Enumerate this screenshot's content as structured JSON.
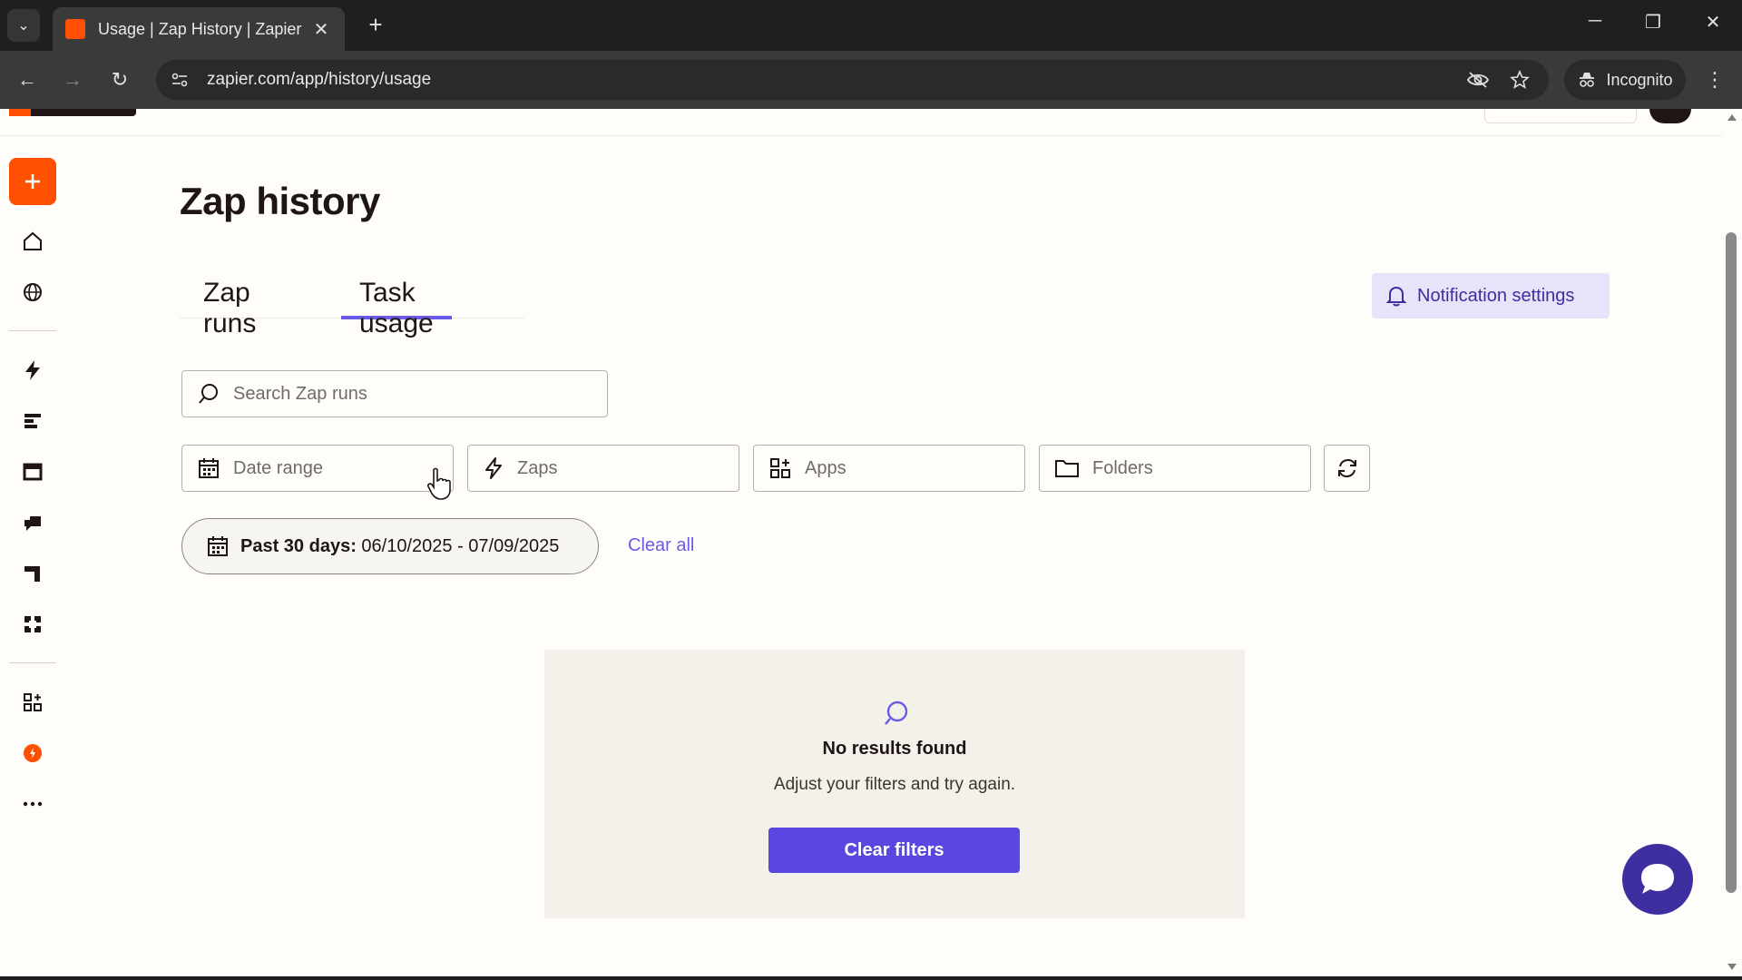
{
  "browser": {
    "tab_title": "Usage | Zap History | Zapier",
    "url": "zapier.com/app/history/usage",
    "incognito_label": "Incognito",
    "favicon_color": "#ff4f00"
  },
  "sidebar": {
    "items": [
      {
        "icon": "plus-icon",
        "label": "Create"
      },
      {
        "icon": "home-icon"
      },
      {
        "icon": "globe-icon"
      },
      {
        "icon": "lightning-icon"
      },
      {
        "icon": "tables-icon"
      },
      {
        "icon": "interfaces-icon"
      },
      {
        "icon": "chatbots-icon"
      },
      {
        "icon": "canvas-icon"
      },
      {
        "icon": "agents-icon"
      },
      {
        "icon": "apps-icon"
      },
      {
        "icon": "zap-history-icon"
      },
      {
        "icon": "more-icon"
      }
    ]
  },
  "page": {
    "title": "Zap history",
    "tabs": [
      {
        "label": "Zap runs",
        "active": false
      },
      {
        "label": "Task usage",
        "active": true
      }
    ],
    "notification_button": "Notification settings",
    "search_placeholder": "Search Zap runs",
    "filters": [
      {
        "label": "Date range",
        "icon": "calendar-icon"
      },
      {
        "label": "Zaps",
        "icon": "lightning-icon"
      },
      {
        "label": "Apps",
        "icon": "apps-icon"
      },
      {
        "label": "Folders",
        "icon": "folder-icon"
      }
    ],
    "active_filter": {
      "label": "Past 30 days:",
      "value": "06/10/2025 - 07/09/2025"
    },
    "clear_all": "Clear all",
    "empty_state": {
      "title": "No results found",
      "subtitle": "Adjust your filters and try again.",
      "button": "Clear filters"
    }
  },
  "colors": {
    "brand_orange": "#ff4f00",
    "accent_purple": "#695be8",
    "button_purple": "#5a46e0",
    "notif_bg": "#e7e3f8"
  }
}
